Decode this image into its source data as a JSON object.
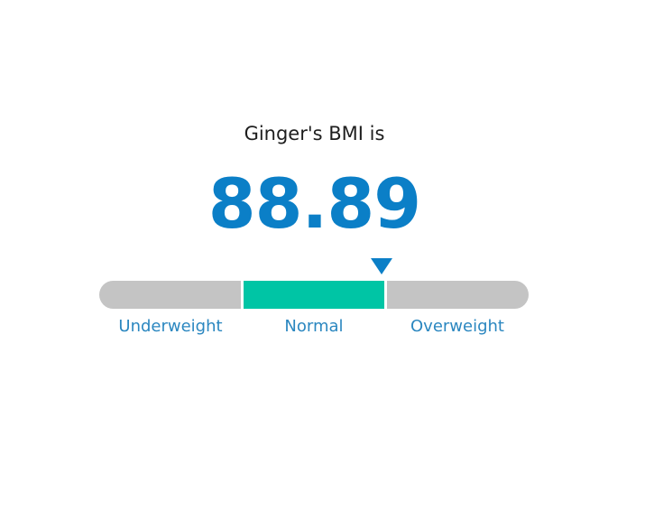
{
  "result": {
    "heading": "Ginger's BMI is",
    "value": "88.89",
    "value_color": "#0b7fc7"
  },
  "scale": {
    "segments": [
      {
        "label": "Underweight",
        "color": "#c4c4c4"
      },
      {
        "label": "Normal",
        "color": "#00c5a5"
      },
      {
        "label": "Overweight",
        "color": "#c4c4c4"
      }
    ],
    "label_color": "#2b87c0",
    "marker_icon": "triangle-down-icon"
  }
}
